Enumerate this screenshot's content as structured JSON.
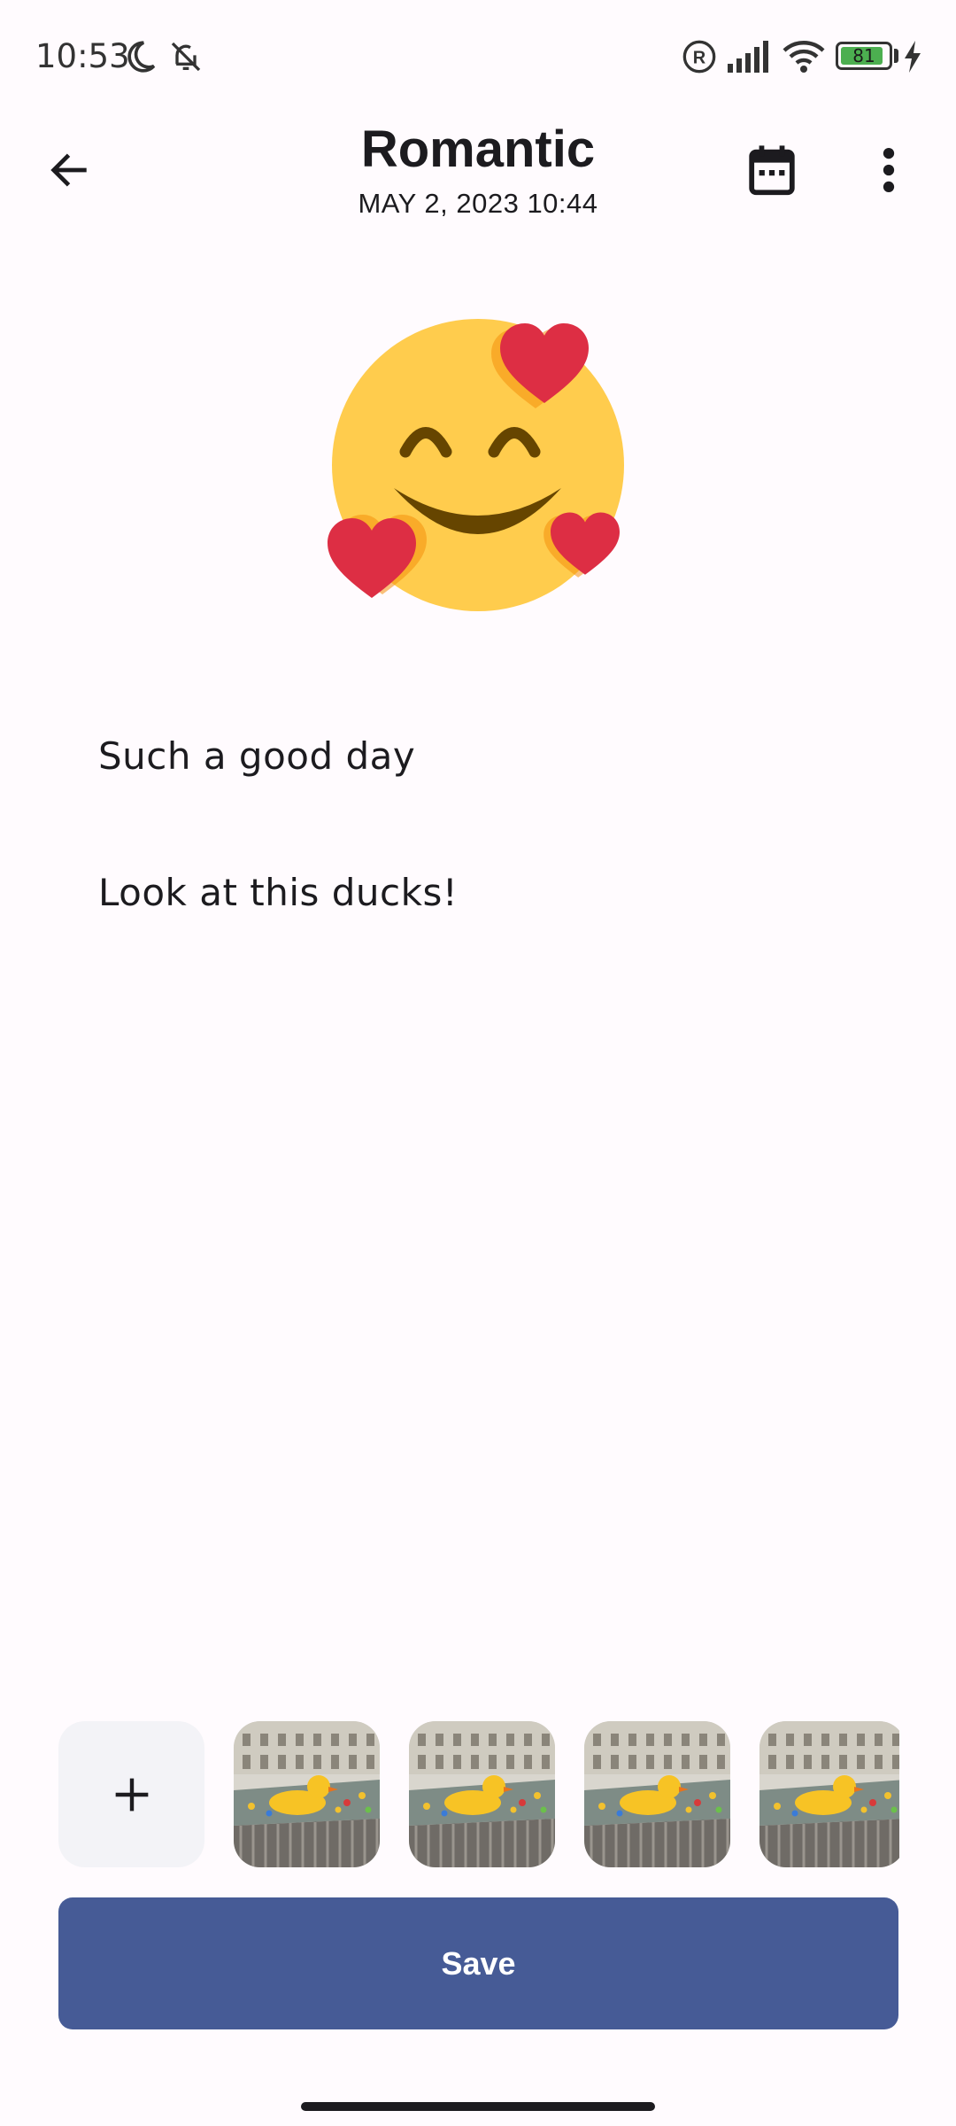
{
  "status_bar": {
    "time": "10:53",
    "battery_level": "81",
    "icons": [
      "moon-icon",
      "notifications-off-icon",
      "registered-icon",
      "signal-icon",
      "wifi-icon",
      "battery-icon",
      "charging-icon"
    ]
  },
  "app_bar": {
    "title": "Romantic",
    "date": "MAY 2, 2023 10:44",
    "icons": [
      "back-arrow-icon",
      "calendar-icon",
      "more-vert-icon"
    ]
  },
  "mood": {
    "emoji_name": "smiling-face-with-hearts-icon"
  },
  "entry": {
    "lines": [
      "Such a good day",
      "Look at this ducks!"
    ]
  },
  "photos": {
    "add_icon": "plus-icon",
    "count_visible": 4
  },
  "actions": {
    "save_label": "Save"
  },
  "colors": {
    "background": "#FFFBFE",
    "primary": "#465B96",
    "emoji_face": "#FFCC4D",
    "heart": "#DD2E44"
  }
}
